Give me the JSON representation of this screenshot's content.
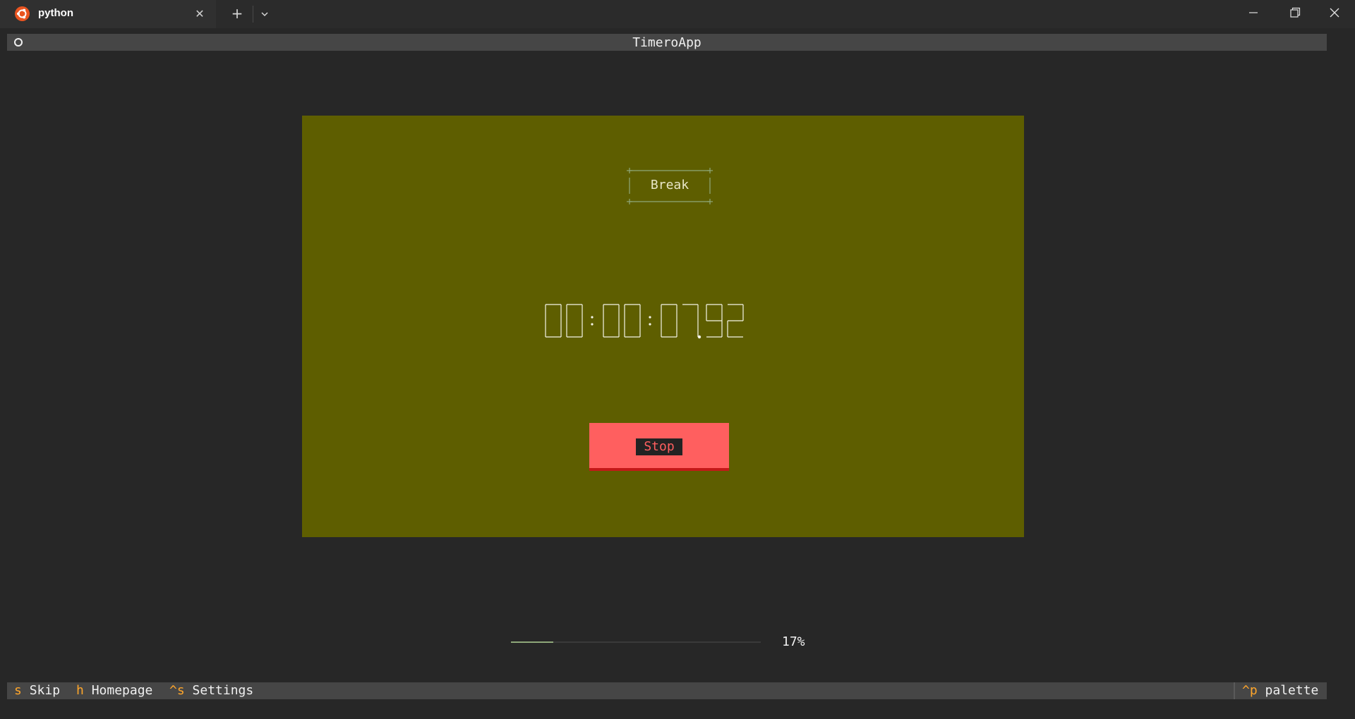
{
  "window": {
    "tab_title": "python",
    "tab_icon": "ubuntu-icon",
    "new_tab_symbol": "+",
    "close_symbol": "✕",
    "colors": {
      "tab_icon": "#e95420",
      "titlebar": "#2b2b2b"
    }
  },
  "app": {
    "title": "TimeroApp",
    "mode_label": "Break",
    "timer": {
      "hours": "00",
      "minutes": "00",
      "seconds": "07",
      "fraction": "92",
      "display": "00:00:07.92"
    },
    "stop_label": "Stop",
    "progress": {
      "fraction": 0.17,
      "text": "17%"
    },
    "colors": {
      "panel": "#5e5e00",
      "stop_button": "#ff5f5f",
      "accent_key": "#ffa62b",
      "progress": "#8fa87a"
    }
  },
  "footer": {
    "bindings": [
      {
        "key": "s",
        "label": "Skip"
      },
      {
        "key": "h",
        "label": "Homepage"
      },
      {
        "key": "^s",
        "label": "Settings"
      }
    ],
    "palette": {
      "key": "^p",
      "label": "palette"
    }
  }
}
